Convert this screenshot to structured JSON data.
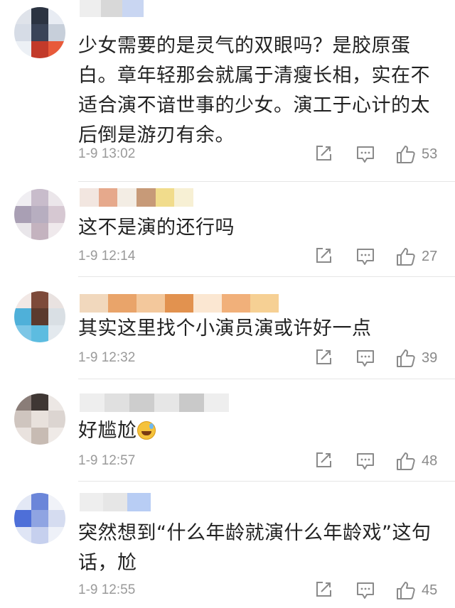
{
  "comments": [
    {
      "text": "少女需要的是灵气的双眼吗？是胶原蛋白。章年轻那会就属于清瘦长相，实在不适合演不谙世事的少女。演工于心计的太后倒是游刃有余。",
      "time": "1-9 13:02",
      "likes": "53",
      "avatar_colors": [
        "#dfe3ea",
        "#2c3442",
        "#e8ecf3",
        "#d6dce6",
        "#3a4458",
        "#c7cfda",
        "#ecf0f5",
        "#c23a2a",
        "#e85a3a"
      ],
      "name_colors": [
        "#eeeeee",
        "#d8d8d8",
        "#c9d6f2"
      ]
    },
    {
      "text": "这不是演的还行吗",
      "time": "1-9 12:14",
      "likes": "27",
      "avatar_colors": [
        "#f0eef2",
        "#c8bccb",
        "#ebe6ea",
        "#a99fb4",
        "#b7aec0",
        "#d6c8d2",
        "#e9e6ea",
        "#c4b3bf",
        "#efe9ec"
      ],
      "name_colors": [
        "#f2e6e0",
        "#e6a98c",
        "#f3ede4",
        "#c79a78",
        "#f1dc8c",
        "#f7f0d4"
      ]
    },
    {
      "text": "其实这里找个小演员演或许好一点",
      "time": "1-9 12:32",
      "likes": "39",
      "avatar_colors": [
        "#f2e8e5",
        "#7d4a3a",
        "#e9e2e0",
        "#4fb0d9",
        "#5b3a2e",
        "#d9dfe4",
        "#7cc6e6",
        "#5dbce0",
        "#e3e9ee"
      ],
      "name_colors": [
        "#f1d8bd",
        "#e9a46a",
        "#f3c89c",
        "#e2924f",
        "#fbe7d2",
        "#f1b07a",
        "#f6d094"
      ]
    },
    {
      "text": "好尴尬",
      "time": "1-9 12:57",
      "likes": "48",
      "avatar_colors": [
        "#8a7d78",
        "#3f3734",
        "#ece7e4",
        "#cfc5bf",
        "#e8e1dc",
        "#dcd5d1",
        "#e9e2de",
        "#c7bbb3",
        "#efeae7"
      ],
      "name_colors": [
        "#eeeeee",
        "#e0e0e0",
        "#cdcdcd",
        "#e6e6e6",
        "#c9c9c9",
        "#eeeeee"
      ]
    },
    {
      "text": "突然想到“什么年龄就演什么年龄戏”这句话，尬",
      "time": "1-9 12:55",
      "likes": "45",
      "avatar_colors": [
        "#e3e8f5",
        "#6b86d9",
        "#f0f2f8",
        "#4e6fd8",
        "#8fa4e2",
        "#d5dcf0",
        "#dfe5f5",
        "#c6d0ee",
        "#eef1f8"
      ],
      "name_colors": [
        "#eeeeee",
        "#e6e6e6",
        "#b8cdf4"
      ]
    }
  ],
  "icons": {
    "repost": "repost-icon",
    "reply": "reply-icon",
    "like": "like-icon"
  }
}
